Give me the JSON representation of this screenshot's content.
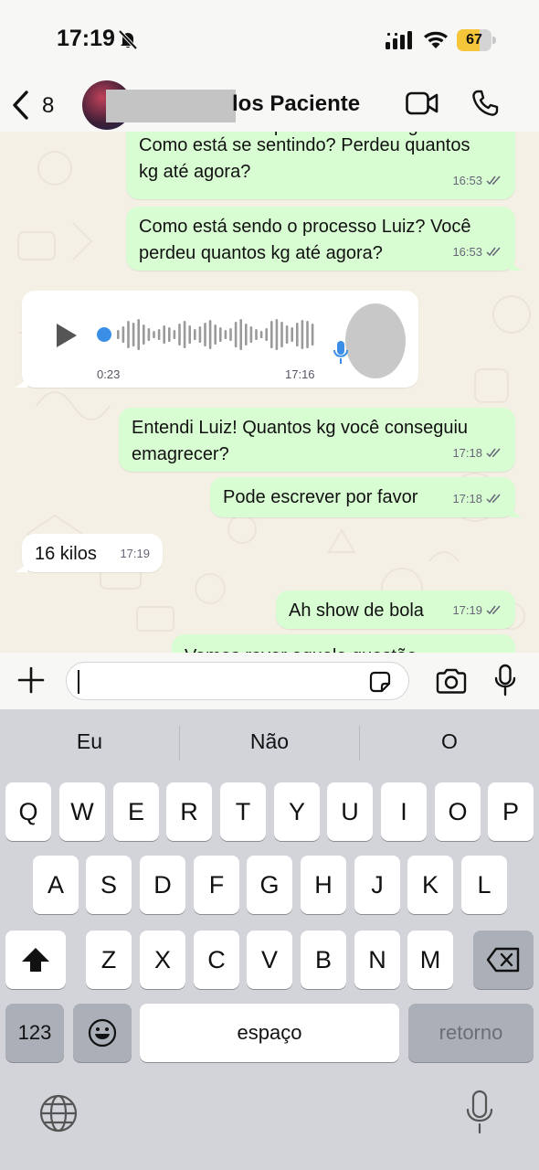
{
  "status": {
    "time": "17:19",
    "battery": "67",
    "battery_level_pct": 67
  },
  "header": {
    "back_count": "8",
    "contact_name_visible": "los Paciente"
  },
  "messages": [
    {
      "direction": "out",
      "text": "Como está se sentindo? Perdeu quantos kg até agora?",
      "partial_top_text": "Você ainda está precisando de algo?",
      "time": "16:53"
    },
    {
      "direction": "out",
      "text": "Como está sendo o processo Luiz? Você perdeu quantos kg até agora?",
      "time": "16:53"
    },
    {
      "direction": "in",
      "type": "voice",
      "duration": "0:23",
      "time": "17:16"
    },
    {
      "direction": "out",
      "text": "Entendi Luiz! Quantos kg você conseguiu emagrecer?",
      "time": "17:18"
    },
    {
      "direction": "out",
      "text": "Pode escrever por favor",
      "time": "17:18"
    },
    {
      "direction": "in",
      "text": "16 kilos",
      "time": "17:19"
    },
    {
      "direction": "out",
      "text": "Ah show de bola",
      "time": "17:19"
    },
    {
      "direction": "out",
      "text": "Vamos rever aquela questão",
      "time": ""
    }
  ],
  "composer": {
    "value": "",
    "icons": [
      "plus-icon",
      "sticker-icon",
      "camera-icon",
      "mic-icon"
    ]
  },
  "keyboard": {
    "suggestions": [
      "Eu",
      "Não",
      "O"
    ],
    "row1": [
      "Q",
      "W",
      "E",
      "R",
      "T",
      "Y",
      "U",
      "I",
      "O",
      "P"
    ],
    "row2": [
      "A",
      "S",
      "D",
      "F",
      "G",
      "H",
      "J",
      "K",
      "L"
    ],
    "row3": [
      "Z",
      "X",
      "C",
      "V",
      "B",
      "N",
      "M"
    ],
    "numbers_key": "123",
    "space_key": "espaço",
    "return_key": "retorno"
  },
  "colors": {
    "outgoing_bubble": "#d9fdd3",
    "incoming_bubble": "#ffffff",
    "chat_background": "#f4f0e6",
    "voice_accent": "#3a8ee6",
    "battery": "#f5c63a"
  }
}
